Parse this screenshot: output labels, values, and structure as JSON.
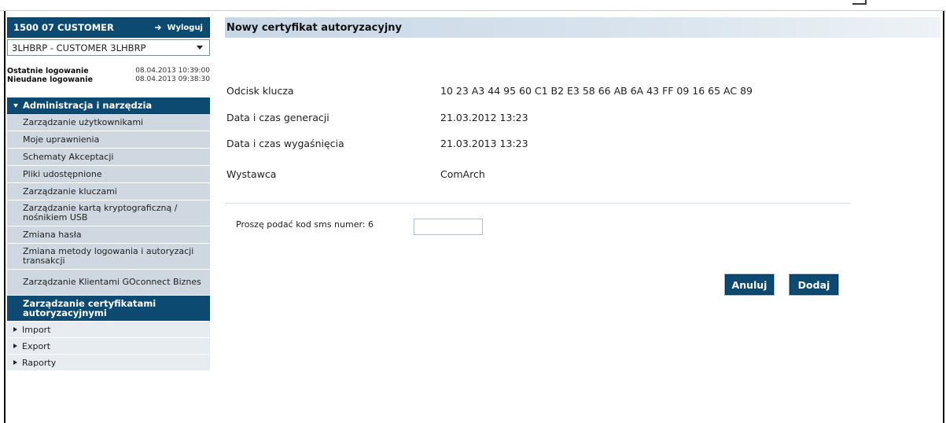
{
  "user": {
    "name": "1500 07 CUSTOMER",
    "logout_label": "Wyloguj"
  },
  "client_select": {
    "value": "3LHBRP - CUSTOMER 3LHBRP"
  },
  "login_info": {
    "last_label": "Ostatnie logowanie",
    "last_value": "08.04.2013 10:39:00",
    "failed_label": "Nieudane logowanie",
    "failed_value": "08.04.2013 09:38:30"
  },
  "menu": {
    "header": "Administracja i narzędzia",
    "items": [
      "Zarządzanie użytkownikami",
      "Moje uprawnienia",
      "Schematy Akceptacji",
      "Pliki udostępnione",
      "Zarządzanie kluczami",
      "Zarządzanie kartą kryptograficzną / nośnikiem USB",
      "Zmiana hasła",
      "Zmiana metody logowania i autoryzacji transakcji",
      "Zarządzanie Klientami GOconnect Biznes",
      "Zarządzanie certyfikatami autoryzacyjnymi"
    ],
    "sub": [
      "Import",
      "Export",
      "Raporty"
    ]
  },
  "page": {
    "title": "Nowy certyfikat autoryzacyjny",
    "fingerprint_label": "Odcisk klucza",
    "fingerprint_value": "10 23 A3 44 95 60 C1 B2 E3 58 66 AB 6A 43 FF 09 16 65 AC 89",
    "generated_label": "Data i czas generacji",
    "generated_value": "21.03.2012 13:23",
    "expires_label": "Data i czas wygaśnięcia",
    "expires_value": "21.03.2013 13:23",
    "issuer_label": "Wystawca",
    "issuer_value": "ComArch",
    "sms_label": "Proszę podać kod sms numer: 6",
    "sms_value": "",
    "cancel_label": "Anuluj",
    "add_label": "Dodaj"
  },
  "colors": {
    "primary": "#0d4a72",
    "menu_item_bg": "#cfd8e0",
    "sub_item_bg": "#e7ecf0"
  }
}
